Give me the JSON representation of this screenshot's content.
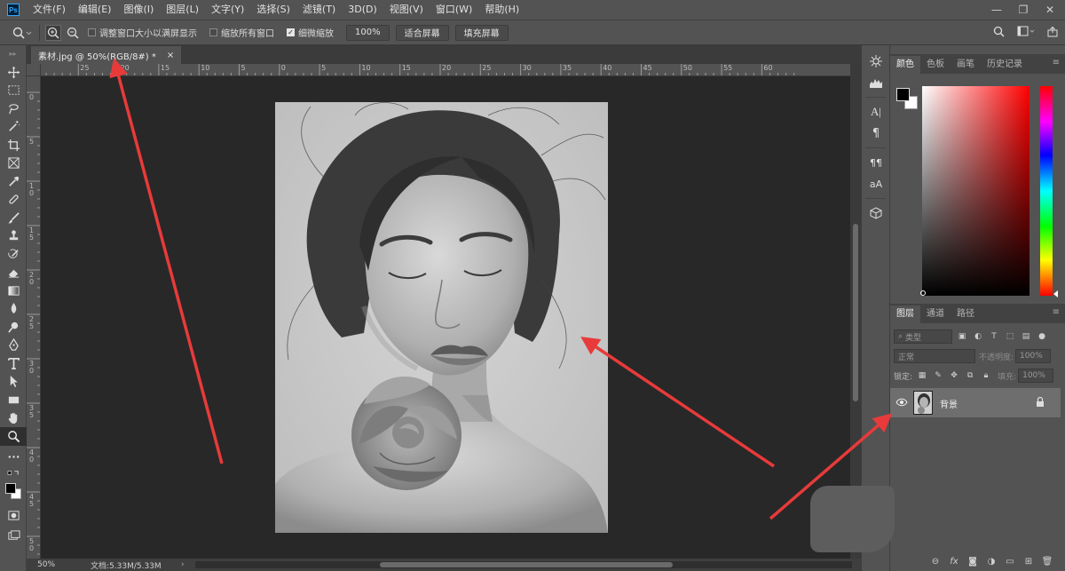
{
  "app": {
    "logo": "Ps"
  },
  "menu": [
    "文件(F)",
    "编辑(E)",
    "图像(I)",
    "图层(L)",
    "文字(Y)",
    "选择(S)",
    "滤镜(T)",
    "3D(D)",
    "视图(V)",
    "窗口(W)",
    "帮助(H)"
  ],
  "window_controls": {
    "minimize": "—",
    "restore": "❐",
    "close": "✕"
  },
  "options": {
    "checkbox_resize": "调整窗口大小以满屏显示",
    "checkbox_zoom_all": "缩放所有窗口",
    "checkbox_scrubby": "细微缩放",
    "zoom_value": "100%",
    "fit_screen": "适合屏幕",
    "fill_screen": "填充屏幕"
  },
  "document": {
    "tab_title": "素材.jpg @ 50%(RGB/8#) *",
    "close": "×"
  },
  "ruler": {
    "top": [
      "30",
      "25",
      "20",
      "15",
      "10",
      "5",
      "0",
      "5",
      "10",
      "15",
      "20",
      "25",
      "30",
      "35",
      "40",
      "45",
      "50",
      "55",
      "60"
    ],
    "left": [
      "0",
      "5",
      "1 0",
      "1 5",
      "2 0",
      "2 5",
      "3 0",
      "3 5",
      "4 0",
      "4 5",
      "5 0"
    ]
  },
  "status": {
    "zoom": "50%",
    "doc": "文档:5.33M/5.33M",
    "arrow": "›"
  },
  "color_panel": {
    "tabs": [
      "颜色",
      "色板",
      "画笔",
      "历史记录"
    ]
  },
  "layers_panel": {
    "tabs": [
      "图层",
      "通道",
      "路径"
    ],
    "filter_placeholder": "类型",
    "blend_mode": "正常",
    "opacity_label": "不透明度:",
    "opacity_value": "100%",
    "lock_label": "锁定:",
    "fill_label": "填充:",
    "fill_value": "100%",
    "layer_name": "背景"
  },
  "colors": {
    "accent_arrow": "#e83a3a",
    "canvas_bg": "#282828",
    "panel_bg": "#535353"
  }
}
